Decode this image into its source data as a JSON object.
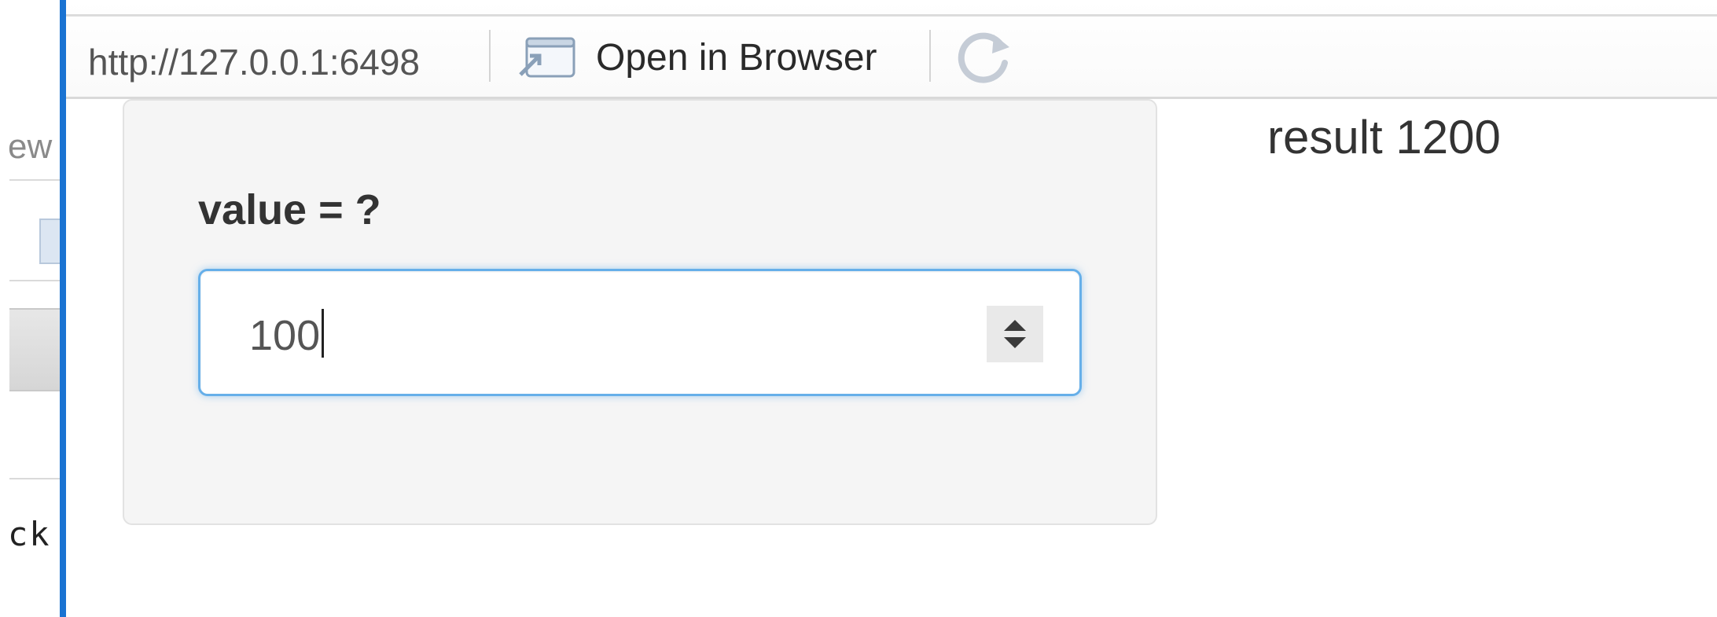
{
  "left_panel": {
    "partial_text": "ew",
    "partial_code": "ck"
  },
  "viewer": {
    "url": "http://127.0.0.1:6498",
    "open_in_browser_label": "Open in Browser",
    "icons": {
      "open_in_browser": "window-popout-icon",
      "refresh": "refresh-icon"
    }
  },
  "app": {
    "input_label": "value = ?",
    "input_value": "100",
    "result_text": "result 1200"
  },
  "colors": {
    "viewer_border": "#1a73d2",
    "input_focus_border": "#66afe9",
    "panel_background": "#f5f5f5"
  }
}
